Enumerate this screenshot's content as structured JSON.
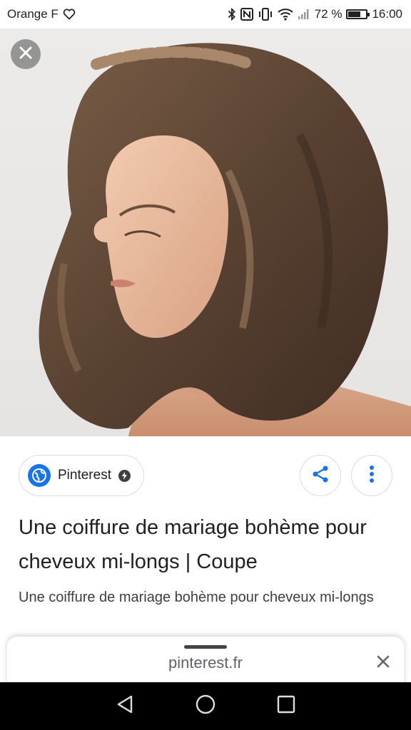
{
  "status_bar": {
    "carrier": "Orange F",
    "battery_percent": "72 %",
    "battery_level": 0.72,
    "time": "16:00",
    "icons": [
      "heart-outline-icon",
      "bluetooth-icon",
      "nfc-icon",
      "vibrate-icon",
      "wifi-icon",
      "signal-icon",
      "battery-icon"
    ]
  },
  "image": {
    "alt": "Une coiffure de mariage bohème pour cheveux mi-longs",
    "close_icon": "close-icon"
  },
  "source": {
    "name": "Pinterest",
    "favicon_icon": "globe-icon",
    "verified_icon": "verified-badge-icon"
  },
  "actions": {
    "share_icon": "share-icon",
    "more_icon": "more-vert-icon"
  },
  "result": {
    "title": "Une coiffure de mariage bohème pour cheveux mi-longs | Coupe",
    "description": "Une coiffure de mariage bohème pour cheveux mi-longs"
  },
  "bottom_sheet": {
    "url": "pinterest.fr",
    "close_icon": "close-icon"
  },
  "nav_bar": {
    "icons": [
      "back-triangle-icon",
      "home-circle-icon",
      "recents-square-icon"
    ]
  },
  "colors": {
    "accent_blue": "#1a73e8",
    "text_primary": "#202124",
    "text_secondary": "#3c4043",
    "border": "#dadce0",
    "nav_background": "#000000"
  }
}
